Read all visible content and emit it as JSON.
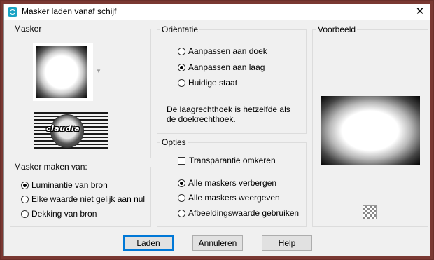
{
  "window": {
    "title": "Masker laden vanaf schijf",
    "close": "✕"
  },
  "masker": {
    "label": "Masker",
    "logo_text": "claudia"
  },
  "orientatie": {
    "label": "Oriëntatie",
    "options": [
      {
        "label": "Aanpassen aan doek",
        "selected": false
      },
      {
        "label": "Aanpassen aan laag",
        "selected": true
      },
      {
        "label": "Huidige staat",
        "selected": false
      }
    ],
    "note": "De laagrechthoek is hetzelfde als de doekrechthoek."
  },
  "maken": {
    "label": "Masker maken van:",
    "options": [
      {
        "label": "Luminantie van bron",
        "selected": true
      },
      {
        "label": "Elke waarde niet gelijk aan nul",
        "selected": false
      },
      {
        "label": "Dekking van bron",
        "selected": false
      }
    ]
  },
  "opties": {
    "label": "Opties",
    "checkbox": {
      "label": "Transparantie omkeren",
      "checked": false
    },
    "options": [
      {
        "label": "Alle maskers verbergen",
        "selected": true
      },
      {
        "label": "Alle maskers weergeven",
        "selected": false
      },
      {
        "label": "Afbeeldingswaarde gebruiken",
        "selected": false
      }
    ]
  },
  "voorbeeld": {
    "label": "Voorbeeld"
  },
  "buttons": {
    "load": "Laden",
    "cancel": "Annuleren",
    "help": "Help"
  },
  "colors": {
    "accent": "#0078d7",
    "window_frame": "#7a3832"
  }
}
